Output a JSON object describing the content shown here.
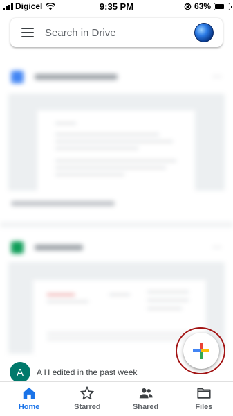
{
  "status_bar": {
    "carrier": "Digicel",
    "time": "9:35 PM",
    "battery_percent": "63%",
    "battery_level": 0.63
  },
  "search": {
    "placeholder": "Search in Drive"
  },
  "activity": {
    "avatar_initial": "A",
    "text": "A H edited in the past week",
    "avatar_color": "#00796b"
  },
  "fab": {
    "icon": "plus-icon",
    "highlight_color": "#a31515"
  },
  "bottom_nav": {
    "items": [
      {
        "label": "Home",
        "icon": "home-icon",
        "active": true
      },
      {
        "label": "Starred",
        "icon": "star-icon",
        "active": false
      },
      {
        "label": "Shared",
        "icon": "people-icon",
        "active": false
      },
      {
        "label": "Files",
        "icon": "folder-icon",
        "active": false
      }
    ],
    "active_color": "#1a73e8"
  }
}
